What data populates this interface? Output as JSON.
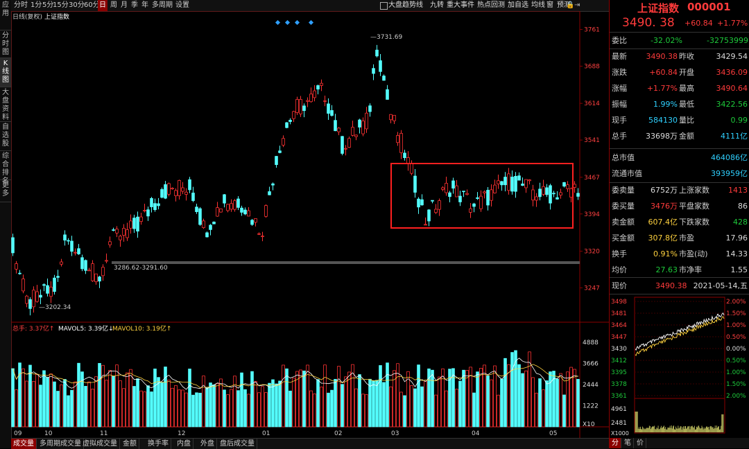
{
  "left_tabs": [
    "应用",
    "分时图",
    "K线图",
    "大盘资料",
    "自选股",
    "综合排名",
    "更多"
  ],
  "toolbar": {
    "periods": [
      "分时",
      "1分",
      "5分",
      "15分",
      "30分",
      "60分",
      "日",
      "周",
      "月",
      "季",
      "年",
      "多周期",
      "设置"
    ],
    "selected": "日",
    "right": [
      "大盘趋势线",
      "九转",
      "重大事件",
      "热点回测",
      "加自选",
      "均线",
      "窗",
      "预测"
    ]
  },
  "chart": {
    "title_prefix": "日线(复权)",
    "title": "上证指数",
    "price_axis": [
      "3761",
      "3688",
      "3614",
      "3541",
      "3467",
      "3394",
      "3320",
      "3247"
    ],
    "price_min": 3180,
    "price_max": 3770,
    "annotations": {
      "high": "3731.69",
      "low": "3202.34",
      "range": "3286.62-3291.60"
    },
    "months": [
      "09",
      "10",
      "11",
      "12",
      "01",
      "02",
      "03",
      "04",
      "05"
    ],
    "vol_legend": {
      "total": "总手: 3.37亿↑",
      "mavol5": "MAVOL5: 3.39亿↓",
      "mavol10": "MAVOL10: 3.19亿↑"
    },
    "vol_axis": [
      "4888",
      "3666",
      "2444",
      "1222",
      "X10"
    ],
    "colors": {
      "up": "#ff3333",
      "down": "#54ffff",
      "ma5": "#ffffff",
      "ma10": "#ffd23f",
      "box": "#ff2020"
    }
  },
  "bottom_tabs": [
    "成交量",
    "多周期成交量",
    "虚拟成交量",
    "金额",
    "换手率",
    "内盘",
    "外盘",
    "盘后成交量"
  ],
  "quote": {
    "name": "上证指数",
    "code": "000001",
    "price": "3490. 38",
    "change": "+60.84",
    "pct": "+1.77%",
    "weibi": {
      "label": "委比",
      "v1": "-32.02%",
      "v2": "-32753999"
    },
    "rows": [
      {
        "l": "最新",
        "v": "3490.38",
        "vc": "red",
        "l2": "昨收",
        "v2": "3429.54",
        "v2c": "white"
      },
      {
        "l": "涨跌",
        "v": "+60.84",
        "vc": "red",
        "l2": "开盘",
        "v2": "3436.09",
        "v2c": "red"
      },
      {
        "l": "涨幅",
        "v": "+1.77%",
        "vc": "red",
        "l2": "最高",
        "v2": "3490.64",
        "v2c": "red"
      },
      {
        "l": "振幅",
        "v": "1.99%",
        "vc": "cyan",
        "l2": "最低",
        "v2": "3422.56",
        "v2c": "grn"
      },
      {
        "l": "现手",
        "v": "584130",
        "vc": "cyan",
        "l2": "量比",
        "v2": "0.99",
        "v2c": "grn"
      },
      {
        "l": "总手",
        "v": "33698万",
        "vc": "white",
        "l2": "金额",
        "v2": "4111亿",
        "v2c": "cyan"
      }
    ],
    "cap": [
      {
        "l": "总市值",
        "v": "464086亿"
      },
      {
        "l": "流通市值",
        "v": "393959亿"
      }
    ],
    "rows2": [
      {
        "l": "委卖量",
        "v": "6752万",
        "vc": "white",
        "l2": "上涨家数",
        "v2": "1413",
        "v2c": "red"
      },
      {
        "l": "委买量",
        "v": "3476万",
        "vc": "red",
        "l2": "平盘家数",
        "v2": "86",
        "v2c": "white"
      },
      {
        "l": "卖金额",
        "v": "607.4亿",
        "vc": "yel",
        "l2": "下跌家数",
        "v2": "428",
        "v2c": "grn"
      },
      {
        "l": "买金额",
        "v": "307.8亿",
        "vc": "yel",
        "l2": "市盈",
        "v2": "17.96",
        "v2c": "white"
      },
      {
        "l": "换手",
        "v": "0.91%",
        "vc": "yel",
        "l2": "市盈(动)",
        "v2": "14.33",
        "v2c": "white"
      },
      {
        "l": "均价",
        "v": "27.63",
        "vc": "grn",
        "l2": "市净率",
        "v2": "1.55",
        "v2c": "white"
      }
    ],
    "now": {
      "label": "现价",
      "price": "3490.38",
      "date": "2021-05-14,五"
    },
    "mini": {
      "left": [
        "3498",
        "3481",
        "3464",
        "3447",
        "3430",
        "3412",
        "3395",
        "3378",
        "3361"
      ],
      "right": [
        "2.00%",
        "1.50%",
        "1.00%",
        "0.50%",
        "0.00%",
        "0.50%",
        "1.00%",
        "1.50%",
        "2.00%"
      ],
      "vol": [
        "4961",
        "2481"
      ],
      "unit": "X1000"
    },
    "mini_tabs": [
      "分",
      "笔",
      "价"
    ]
  }
}
